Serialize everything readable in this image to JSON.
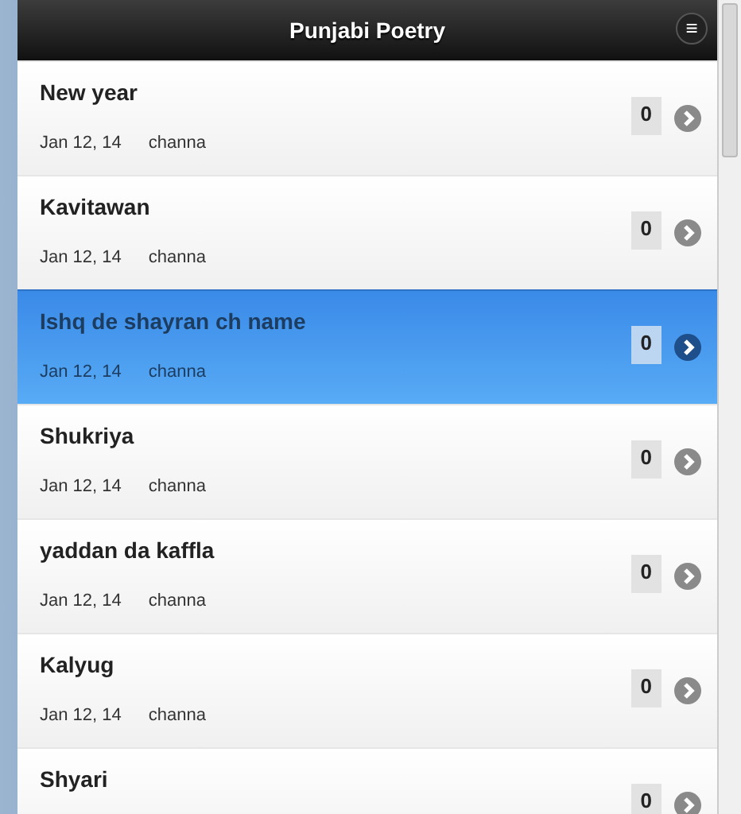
{
  "header": {
    "title": "Punjabi Poetry",
    "menu_button": "≡"
  },
  "posts": [
    {
      "title": "New year",
      "date": "Jan 12, 14",
      "author": "channa",
      "count": "0",
      "selected": false
    },
    {
      "title": "Kavitawan",
      "date": "Jan 12, 14",
      "author": "channa",
      "count": "0",
      "selected": false
    },
    {
      "title": "Ishq de shayran ch name",
      "date": "Jan 12, 14",
      "author": "channa",
      "count": "0",
      "selected": true
    },
    {
      "title": "Shukriya",
      "date": "Jan 12, 14",
      "author": "channa",
      "count": "0",
      "selected": false
    },
    {
      "title": "yaddan da kaffla",
      "date": "Jan 12, 14",
      "author": "channa",
      "count": "0",
      "selected": false
    },
    {
      "title": "Kalyug",
      "date": "Jan 12, 14",
      "author": "channa",
      "count": "0",
      "selected": false
    },
    {
      "title": "Shyari",
      "count": "0",
      "selected": false
    }
  ]
}
